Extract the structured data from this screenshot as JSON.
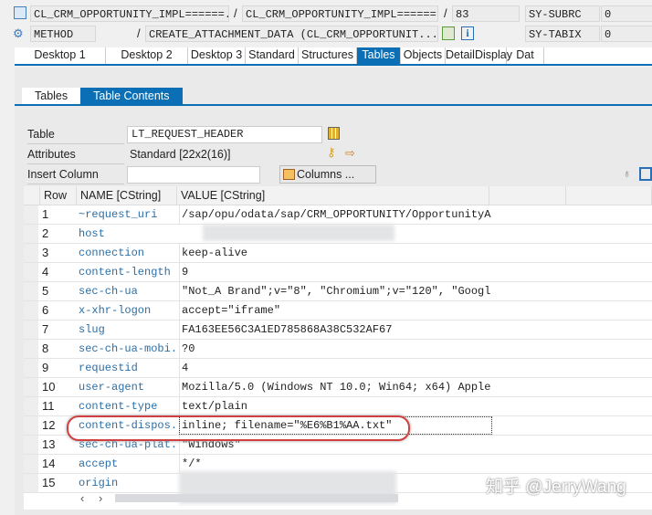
{
  "header": {
    "program": "CL_CRM_OPPORTUNITY_IMPL======...",
    "include": "CL_CRM_OPPORTUNITY_IMPL======...",
    "line": "83",
    "sy_subrc_label": "SY-SUBRC",
    "sy_subrc_value": "0",
    "event_type": "METHOD",
    "event": "CREATE_ATTACHMENT_DATA (CL_CRM_OPPORTUNIT...",
    "sy_tabix_label": "SY-TABIX",
    "sy_tabix_value": "0",
    "slash": "/"
  },
  "tabs": [
    "Desktop 1",
    "Desktop 2",
    "Desktop 3",
    "Standard",
    "Structures",
    "Tables",
    "Objects",
    "DetailDisplay",
    "Dat"
  ],
  "subtabs": [
    "Tables",
    "Table Contents"
  ],
  "form": {
    "table_label": "Table",
    "table_value": "LT_REQUEST_HEADER",
    "attributes_label": "Attributes",
    "attributes_value": "Standard [22x2(16)]",
    "insert_label": "Insert Column",
    "insert_value": "",
    "columns_button": "Columns ..."
  },
  "grid": {
    "headers": [
      "Row",
      "NAME [CString]",
      "VALUE [CString]"
    ],
    "rows": [
      {
        "n": "1",
        "name": "~request_uri",
        "value": "/sap/opu/odata/sap/CRM_OPPORTUNITY/OpportunityA..."
      },
      {
        "n": "2",
        "name": "host",
        "value": ""
      },
      {
        "n": "3",
        "name": "connection",
        "value": "keep-alive"
      },
      {
        "n": "4",
        "name": "content-length",
        "value": "9"
      },
      {
        "n": "5",
        "name": "sec-ch-ua",
        "value": "\"Not_A Brand\";v=\"8\", \"Chromium\";v=\"120\", \"Googl..."
      },
      {
        "n": "6",
        "name": "x-xhr-logon",
        "value": "accept=\"iframe\""
      },
      {
        "n": "7",
        "name": "slug",
        "value": "FA163EE56C3A1ED785868A38C532AF67"
      },
      {
        "n": "8",
        "name": "sec-ch-ua-mobi...",
        "value": "?0"
      },
      {
        "n": "9",
        "name": "requestid",
        "value": "4"
      },
      {
        "n": "10",
        "name": "user-agent",
        "value": "Mozilla/5.0 (Windows NT 10.0; Win64; x64) Apple..."
      },
      {
        "n": "11",
        "name": "content-type",
        "value": "text/plain"
      },
      {
        "n": "12",
        "name": "content-dispos...",
        "value": "inline; filename=\"%E6%B1%AA.txt\""
      },
      {
        "n": "13",
        "name": "sec-ch-ua-plat...",
        "value": "\"Windows\""
      },
      {
        "n": "14",
        "name": "accept",
        "value": "*/*"
      },
      {
        "n": "15",
        "name": "origin",
        "value": ""
      }
    ]
  },
  "watermark": "知乎 @JerryWang",
  "colors": {
    "accent": "#0a6fb5",
    "highlight": "#d04040"
  }
}
